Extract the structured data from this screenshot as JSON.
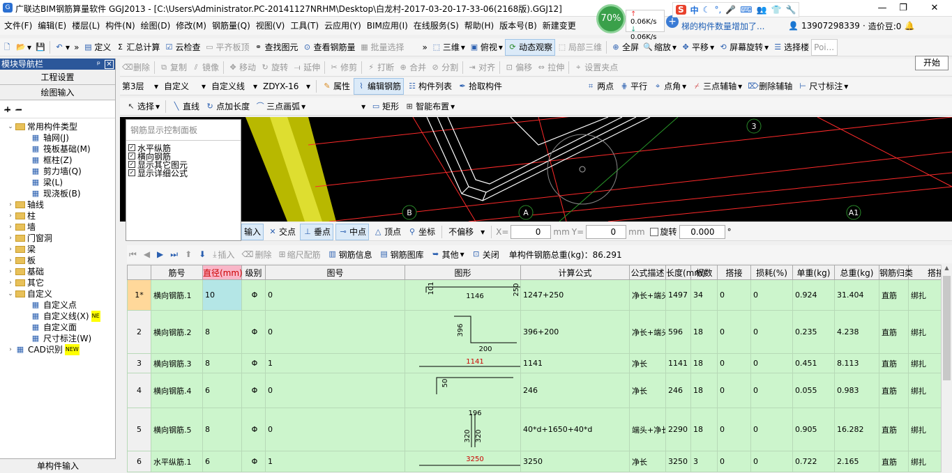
{
  "window": {
    "title": "广联达BIM钢筋算量软件 GGJ2013 - [C:\\Users\\Administrator.PC-20141127NRHM\\Desktop\\白龙村-2017-03-20-17-33-06(2168版).GGJ12]",
    "min": "—",
    "max": "❐",
    "close": "✕"
  },
  "network": {
    "percent": "70%",
    "up": "0.06K/s",
    "down": "0.06K/s"
  },
  "ime": {
    "s": "S",
    "lang": "中"
  },
  "menu": [
    "文件(F)",
    "编辑(E)",
    "楼层(L)",
    "构件(N)",
    "绘图(D)",
    "修改(M)",
    "钢筋量(Q)",
    "视图(V)",
    "工具(T)",
    "云应用(Y)",
    "BIM应用(I)",
    "在线服务(S)",
    "帮助(H)",
    "版本号(B)",
    "新建变更"
  ],
  "notice": "梯的构件数量增加了...",
  "user": {
    "phone": "13907298339",
    "beans": "造价豆:0"
  },
  "toolbar1": {
    "items": [
      "定义",
      "汇总计算",
      "云检查",
      "平齐板顶",
      "查找图元",
      "查看钢筋量",
      "批量选择"
    ],
    "items2": [
      "三维",
      "俯视",
      "动态观察",
      "局部三维",
      "全屏",
      "缩放",
      "平移",
      "屏幕旋转",
      "选择楼",
      "Poi..."
    ],
    "start": "开始"
  },
  "toolbar2": {
    "items": [
      "删除",
      "复制",
      "镜像",
      "移动",
      "旋转",
      "延伸",
      "修剪",
      "打断",
      "合并",
      "分割",
      "对齐",
      "偏移",
      "拉伸",
      "设置夹点"
    ]
  },
  "toolbar3": {
    "floor": "第3层",
    "type": "自定义",
    "sub": "自定义线",
    "name": "ZDYX-16",
    "items": [
      "属性",
      "编辑钢筋",
      "构件列表",
      "拾取构件"
    ],
    "axis": [
      "两点",
      "平行",
      "点角",
      "三点辅轴",
      "删除辅轴",
      "尺寸标注"
    ]
  },
  "toolbar4": {
    "items": [
      "选择",
      "直线",
      "点加长度",
      "三点画弧",
      "矩形",
      "智能布置"
    ]
  },
  "nav": {
    "title": "模块导航栏",
    "pin": "ᵖ",
    "close": "✕",
    "btn1": "工程设置",
    "btn2": "绘图输入",
    "bottom": "单构件输入",
    "tree": [
      {
        "label": "常用构件类型",
        "lvl": 0,
        "exp": "⌄",
        "f": true
      },
      {
        "label": "轴网(J)",
        "lvl": 1
      },
      {
        "label": "筏板基础(M)",
        "lvl": 1
      },
      {
        "label": "框柱(Z)",
        "lvl": 1
      },
      {
        "label": "剪力墙(Q)",
        "lvl": 1
      },
      {
        "label": "梁(L)",
        "lvl": 1
      },
      {
        "label": "现浇板(B)",
        "lvl": 1
      },
      {
        "label": "轴线",
        "lvl": 0,
        "exp": "›",
        "f": true
      },
      {
        "label": "柱",
        "lvl": 0,
        "exp": "›",
        "f": true
      },
      {
        "label": "墙",
        "lvl": 0,
        "exp": "›",
        "f": true
      },
      {
        "label": "门窗洞",
        "lvl": 0,
        "exp": "›",
        "f": true
      },
      {
        "label": "梁",
        "lvl": 0,
        "exp": "›",
        "f": true
      },
      {
        "label": "板",
        "lvl": 0,
        "exp": "›",
        "f": true
      },
      {
        "label": "基础",
        "lvl": 0,
        "exp": "›",
        "f": true
      },
      {
        "label": "其它",
        "lvl": 0,
        "exp": "›",
        "f": true
      },
      {
        "label": "自定义",
        "lvl": 0,
        "exp": "⌄",
        "f": true
      },
      {
        "label": "自定义点",
        "lvl": 1
      },
      {
        "label": "自定义线(X)",
        "lvl": 1,
        "badge": "NE"
      },
      {
        "label": "自定义面",
        "lvl": 1
      },
      {
        "label": "尺寸标注(W)",
        "lvl": 1
      },
      {
        "label": "CAD识别",
        "lvl": 0,
        "exp": "›",
        "badge": "NEW"
      }
    ]
  },
  "rebar_panel": {
    "title": "钢筋显示控制面板",
    "options": [
      "水平纵筋",
      "横向钢筋",
      "显示其它图元",
      "显示详细公式"
    ]
  },
  "cad": {
    "axes": [
      "3",
      "B",
      "A",
      "A1"
    ]
  },
  "snapbar": {
    "input": "输入",
    "items": [
      "交点",
      "垂点",
      "中点",
      "顶点",
      "坐标"
    ],
    "offset": "不偏移",
    "x_label": "X=",
    "x": "0",
    "y_label": "Y=",
    "y": "0",
    "unit": "mm",
    "rotate": "旋转",
    "angle": "0.000",
    "deg": "°"
  },
  "gridbar": {
    "items": [
      "插入",
      "删除",
      "缩尺配筋",
      "钢筋信息",
      "钢筋图库",
      "其他",
      "关闭"
    ],
    "total": "单构件钢筋总重(kg)：86.291"
  },
  "table": {
    "headers": [
      "筋号",
      "直径(mm)",
      "级别",
      "图号",
      "图形",
      "计算公式",
      "公式描述",
      "长度(mm)",
      "根数",
      "搭接",
      "损耗(%)",
      "单重(kg)",
      "总重(kg)",
      "钢筋归类",
      "搭接"
    ],
    "rows": [
      {
        "idx": "1*",
        "name": "横向钢筋.1",
        "dia": "10",
        "grade": "Φ",
        "fig": "0",
        "shape": [
          "101",
          "1146",
          "250"
        ],
        "formula": "1247+250",
        "desc": "净长+端头",
        "len": "1497",
        "count": "34",
        "lap": "0",
        "loss": "0",
        "unit": "0.924",
        "total": "31.404",
        "cls": "直筋",
        "lap2": "绑扎"
      },
      {
        "idx": "2",
        "name": "横向钢筋.2",
        "dia": "8",
        "grade": "Φ",
        "fig": "0",
        "shape": [
          "396",
          "200"
        ],
        "formula": "396+200",
        "desc": "净长+端头",
        "len": "596",
        "count": "18",
        "lap": "0",
        "loss": "0",
        "unit": "0.235",
        "total": "4.238",
        "cls": "直筋",
        "lap2": "绑扎"
      },
      {
        "idx": "3",
        "name": "横向钢筋.3",
        "dia": "8",
        "grade": "Φ",
        "fig": "1",
        "shape": [
          "1141"
        ],
        "formula": "1141",
        "desc": "净长",
        "len": "1141",
        "count": "18",
        "lap": "0",
        "loss": "0",
        "unit": "0.451",
        "total": "8.113",
        "cls": "直筋",
        "lap2": "绑扎"
      },
      {
        "idx": "4",
        "name": "横向钢筋.4",
        "dia": "6",
        "grade": "Φ",
        "fig": "0",
        "shape": [
          "50"
        ],
        "formula": "246",
        "desc": "净长",
        "len": "246",
        "count": "18",
        "lap": "0",
        "loss": "0",
        "unit": "0.055",
        "total": "0.983",
        "cls": "直筋",
        "lap2": "绑扎"
      },
      {
        "idx": "5",
        "name": "横向钢筋.5",
        "dia": "8",
        "grade": "Φ",
        "fig": "0",
        "shape": [
          "196",
          "320",
          "320"
        ],
        "formula": "40*d+1650+40*d",
        "desc": "端头+净长+端头",
        "len": "2290",
        "count": "18",
        "lap": "0",
        "loss": "0",
        "unit": "0.905",
        "total": "16.282",
        "cls": "直筋",
        "lap2": "绑扎"
      },
      {
        "idx": "6",
        "name": "水平纵筋.1",
        "dia": "6",
        "grade": "Φ",
        "fig": "1",
        "shape": [
          "3250"
        ],
        "formula": "3250",
        "desc": "净长",
        "len": "3250",
        "count": "3",
        "lap": "0",
        "loss": "0",
        "unit": "0.722",
        "total": "2.165",
        "cls": "直筋",
        "lap2": "绑扎"
      }
    ]
  }
}
